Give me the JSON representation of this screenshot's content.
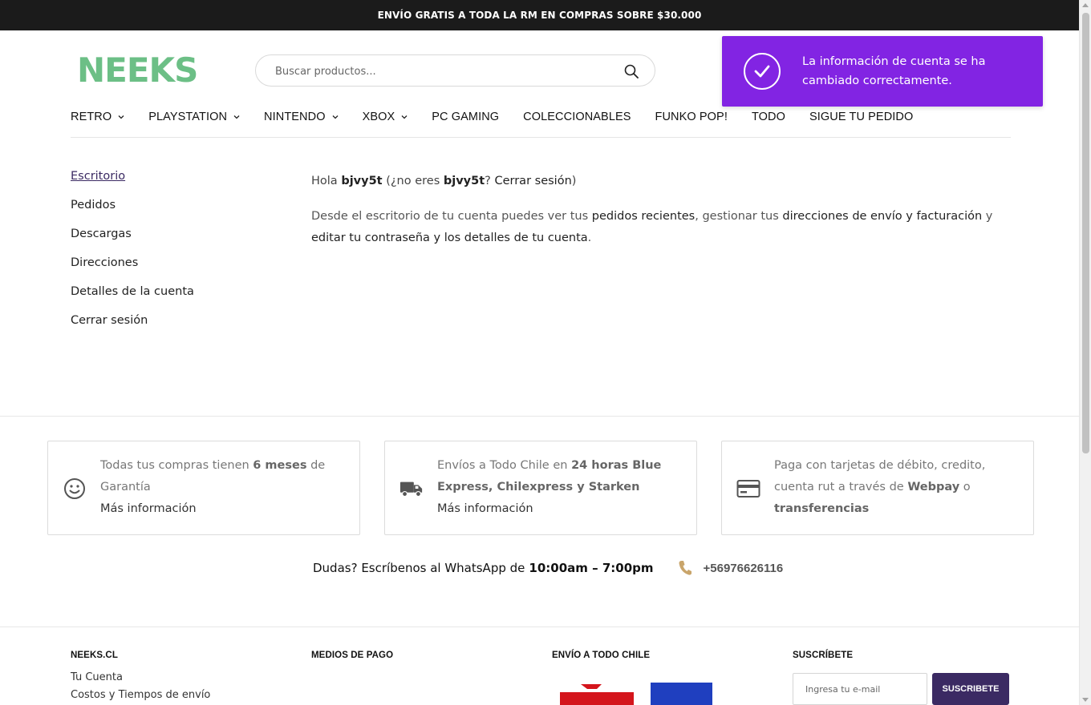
{
  "topbar": {
    "text": "ENVÍO GRATIS A TODA LA RM EN COMPRAS SOBRE $30.000"
  },
  "logo": {
    "text": "NEEKS",
    "color": "#6cbf86"
  },
  "search": {
    "placeholder": "Buscar productos..."
  },
  "nav": {
    "items": [
      {
        "label": "RETRO",
        "dropdown": true
      },
      {
        "label": "PLAYSTATION",
        "dropdown": true
      },
      {
        "label": "NINTENDO",
        "dropdown": true
      },
      {
        "label": "XBOX",
        "dropdown": true
      },
      {
        "label": "PC GAMING",
        "dropdown": false
      },
      {
        "label": "COLECCIONABLES",
        "dropdown": false
      },
      {
        "label": "FUNKO POP!",
        "dropdown": false
      },
      {
        "label": "TODO",
        "dropdown": false
      },
      {
        "label": "SIGUE TU PEDIDO",
        "dropdown": false
      }
    ]
  },
  "toast": {
    "message": "La información de cuenta se ha cambiado correctamente.",
    "color": "#8224e3"
  },
  "account_nav": {
    "items": [
      {
        "label": "Escritorio",
        "active": true
      },
      {
        "label": "Pedidos",
        "active": false
      },
      {
        "label": "Descargas",
        "active": false
      },
      {
        "label": "Direcciones",
        "active": false
      },
      {
        "label": "Detalles de la cuenta",
        "active": false
      },
      {
        "label": "Cerrar sesión",
        "active": false
      }
    ]
  },
  "content": {
    "hello_prefix": "Hola ",
    "username": "bjvy5t",
    "not_you_prefix": " (¿no eres ",
    "not_you_user": "bjvy5t",
    "question_mark": "? ",
    "logout_link": "Cerrar sesión",
    "close_paren": ")",
    "desc_1": "Desde el escritorio de tu cuenta puedes ver tus ",
    "link_orders": "pedidos recientes",
    "desc_2": ", gestionar tus ",
    "link_addresses": "direcciones de envío y facturación",
    "desc_3": " y ",
    "link_edit": "editar tu contraseña y los detalles de tu cuenta",
    "desc_4": "."
  },
  "features": [
    {
      "icon": "smile-icon",
      "text_1": "Todas tus compras tienen ",
      "bold_1": "6 meses",
      "text_2": " de Garantía",
      "bold_2": "",
      "text_3": "",
      "more": "Más información"
    },
    {
      "icon": "truck-icon",
      "text_1": "Envíos a Todo Chile en ",
      "bold_1": "24 horas Blue Express, Chilexpress y Starken",
      "text_2": "",
      "bold_2": "",
      "text_3": "",
      "more": "Más información"
    },
    {
      "icon": "credit-card-icon",
      "text_1": "Paga con tarjetas de débito, credito, cuenta rut a través de ",
      "bold_1": "Webpay",
      "text_2": " o ",
      "bold_2": "transferencias",
      "text_3": "",
      "more": ""
    }
  ],
  "whatsapp": {
    "prefix": "Dudas? Escríbenos al WhatsApp de",
    "hours": "10:00am – 7:00pm",
    "phone": "+56976626116"
  },
  "footer": {
    "col1": {
      "title": "NEEKS.CL",
      "links": [
        "Tu Cuenta",
        "Costos y Tiempos de envío"
      ]
    },
    "col2": {
      "title": "MEDIOS DE PAGO"
    },
    "col3": {
      "title": "ENVÍO A TODO CHILE"
    },
    "col4": {
      "title": "SUSCRÍBETE",
      "placeholder": "Ingresa tu e-mail",
      "button": "SUSCRIBETE"
    }
  },
  "colors": {
    "brand_purple": "#3b2a63",
    "toast_purple": "#8224e3",
    "logo_green": "#6cbf86"
  }
}
